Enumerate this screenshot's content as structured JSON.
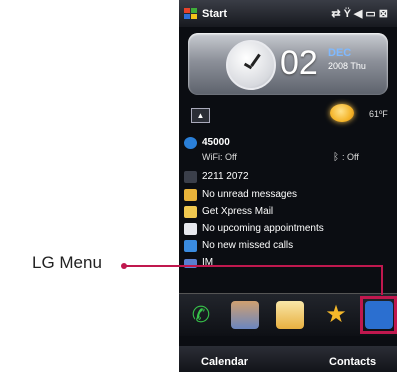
{
  "statusbar": {
    "start_label": "Start",
    "icons": [
      "sync-icon",
      "signal-icon",
      "volume-icon",
      "battery-icon",
      "close-icon"
    ]
  },
  "clock": {
    "hour": "02",
    "month": "DEC",
    "year_day": "2008 Thu"
  },
  "weather": {
    "temperature": "61ºF"
  },
  "status_rows": [
    {
      "icon": "phone-signal-icon",
      "text": "45000"
    },
    {
      "icon": "wifi-icon",
      "text": "WiFi: Off"
    },
    {
      "icon": "bluetooth-icon",
      "text": ": Off"
    },
    {
      "icon": "phone-number-icon",
      "text": "2211 2072"
    },
    {
      "icon": "message-icon",
      "text": "No unread messages"
    },
    {
      "icon": "xpress-mail-icon",
      "text": "Get Xpress Mail"
    },
    {
      "icon": "calendar-icon",
      "text": "No upcoming appointments"
    },
    {
      "icon": "missed-call-icon",
      "text": "No new missed calls"
    },
    {
      "icon": "im-icon",
      "text": "IM"
    }
  ],
  "dock": {
    "items": [
      "phone-icon",
      "contacts-icon",
      "mail-icon",
      "favorites-icon",
      "lg-menu-icon"
    ],
    "highlight_color": "#c0184e"
  },
  "softkeys": {
    "left": "Calendar",
    "right": "Contacts"
  },
  "callout": {
    "label": "LG Menu",
    "color": "#c0184e"
  }
}
